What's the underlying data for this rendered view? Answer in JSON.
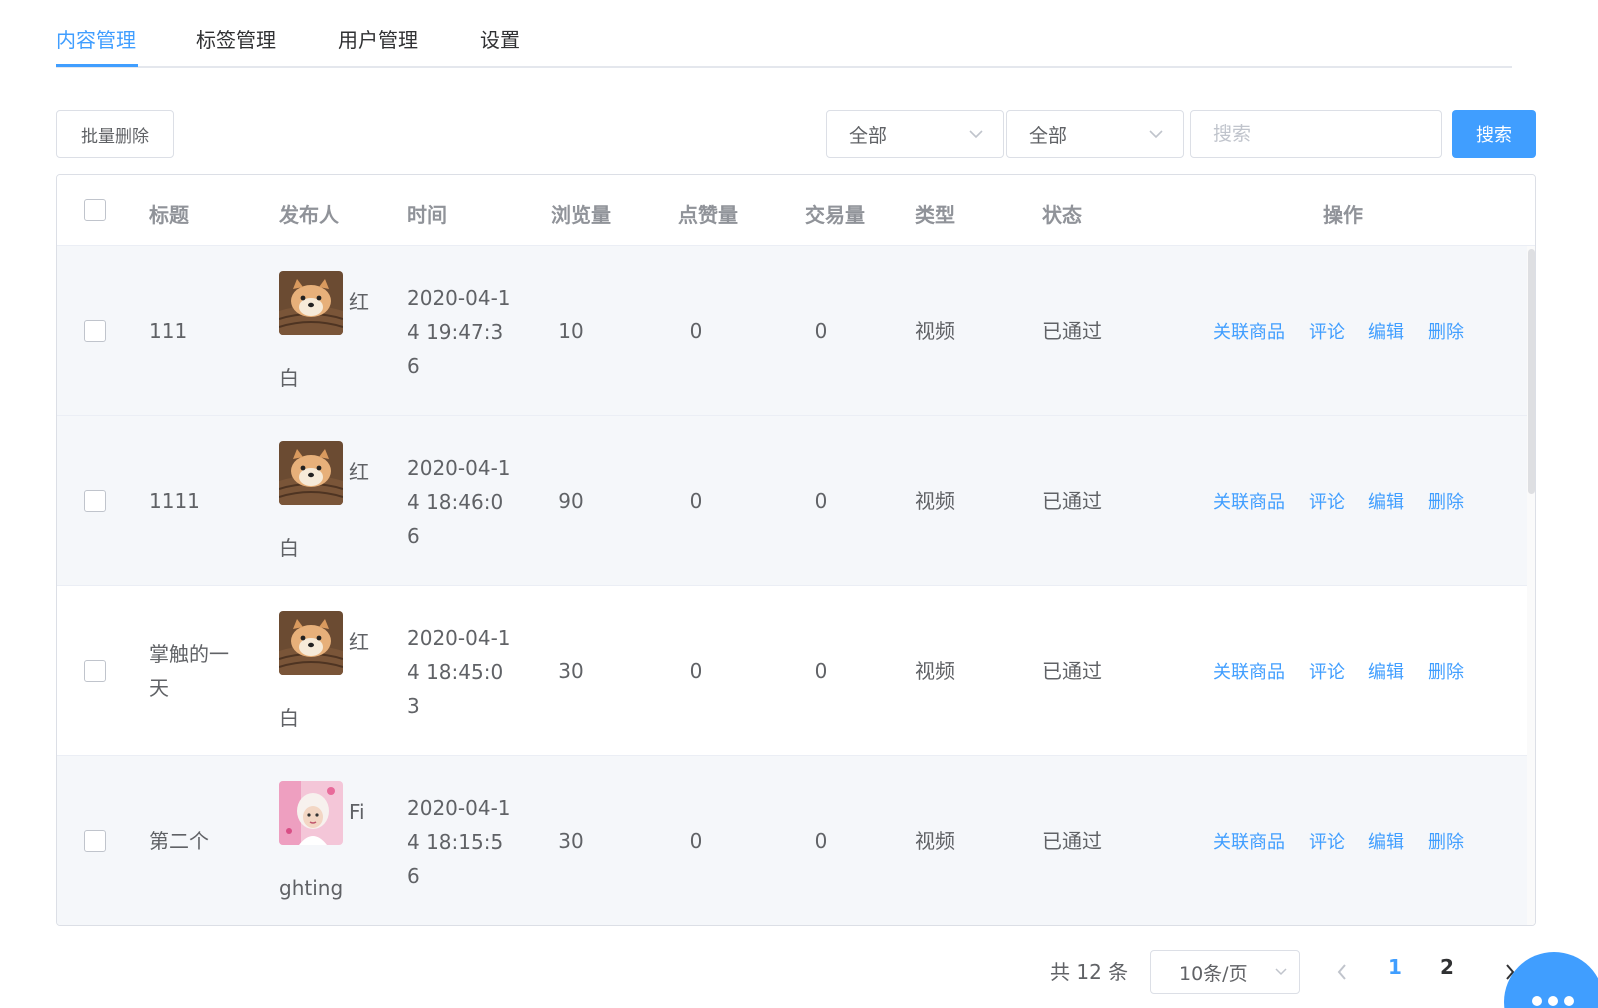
{
  "tabs": [
    {
      "label": "内容管理",
      "active": true
    },
    {
      "label": "标签管理",
      "active": false
    },
    {
      "label": "用户管理",
      "active": false
    },
    {
      "label": "设置",
      "active": false
    }
  ],
  "toolbar": {
    "batch_delete_label": "批量删除",
    "filter1_value": "全部",
    "filter2_value": "全部",
    "search_placeholder": "搜索",
    "search_button_label": "搜索"
  },
  "table": {
    "columns": [
      "标题",
      "发布人",
      "时间",
      "浏览量",
      "点赞量",
      "交易量",
      "类型",
      "状态",
      "操作"
    ],
    "rows": [
      {
        "title": "111",
        "publisher_first": "红",
        "publisher_rest": "白",
        "time": "2020-04-14 19:47:36",
        "views": "10",
        "likes": "0",
        "trades": "0",
        "type": "视频",
        "status": "已通过",
        "avatar": "dog"
      },
      {
        "title": "1111",
        "publisher_first": "红",
        "publisher_rest": "白",
        "time": "2020-04-14 18:46:06",
        "views": "90",
        "likes": "0",
        "trades": "0",
        "type": "视频",
        "status": "已通过",
        "avatar": "dog"
      },
      {
        "title": "掌触的一天",
        "publisher_first": "红",
        "publisher_rest": "白",
        "time": "2020-04-14 18:45:03",
        "views": "30",
        "likes": "0",
        "trades": "0",
        "type": "视频",
        "status": "已通过",
        "avatar": "dog"
      },
      {
        "title": "第二个",
        "publisher_first": "Fi",
        "publisher_rest": "ghting",
        "time": "2020-04-14 18:15:56",
        "views": "30",
        "likes": "0",
        "trades": "0",
        "type": "视频",
        "status": "已通过",
        "avatar": "girl"
      }
    ],
    "actions": [
      "关联商品",
      "评论",
      "编辑",
      "删除"
    ]
  },
  "pagination": {
    "total_text": "共 12 条",
    "page_size": "10条/页",
    "pages": [
      "1",
      "2"
    ],
    "current_page": "1"
  },
  "colors": {
    "primary": "#409eff",
    "text": "#606266",
    "header_text": "#909399",
    "border": "#dcdfe6",
    "stripe": "#f5f7fa"
  },
  "icons": [
    "chevron-down-icon",
    "chevron-left-icon",
    "chevron-right-icon",
    "chat-icon"
  ]
}
